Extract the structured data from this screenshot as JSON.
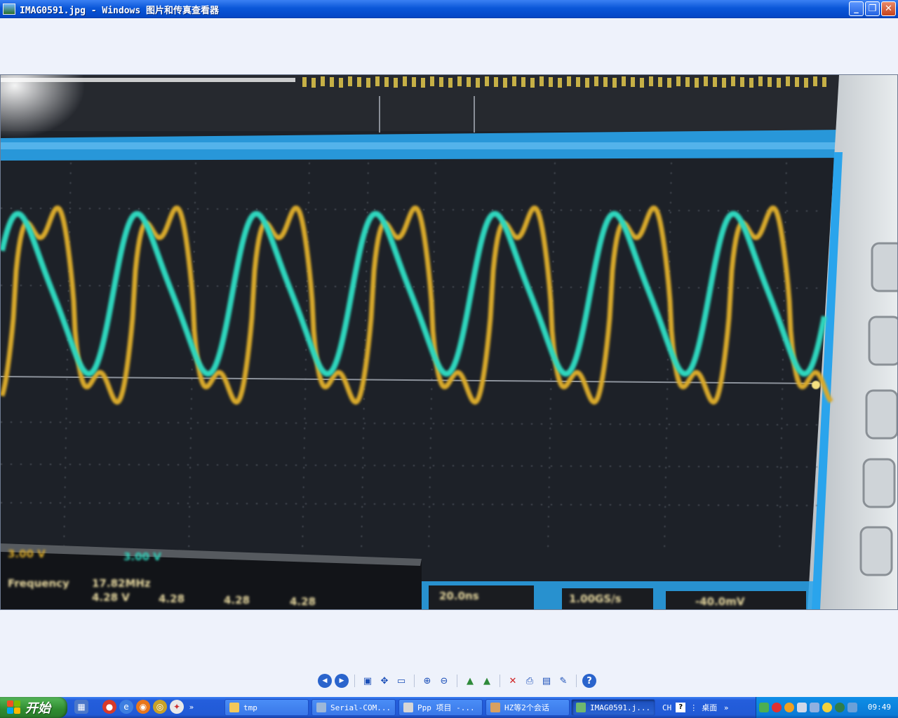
{
  "window": {
    "title": "IMAG0591.jpg - Windows 图片和传真查看器",
    "minimize_label": "_",
    "maximize_label": "❐",
    "close_label": "✕"
  },
  "image": {
    "bottom_readouts": [
      "3.00 V",
      "3.00 V",
      "Frequency",
      "17.82MHz",
      "4.28 V",
      "4.28",
      "4.28",
      "4.28",
      "20.0ns",
      "1.00GS/s",
      "-40.0mV"
    ]
  },
  "viewer_toolbar": {
    "buttons": [
      {
        "name": "previous-image-button",
        "glyph": "◀"
      },
      {
        "name": "next-image-button",
        "glyph": "▶"
      },
      {
        "name": "best-fit-button",
        "glyph": "▣"
      },
      {
        "name": "actual-size-button",
        "glyph": "✥"
      },
      {
        "name": "slideshow-button",
        "glyph": "▭"
      },
      {
        "name": "zoom-in-button",
        "glyph": "⊕"
      },
      {
        "name": "zoom-out-button",
        "glyph": "⊖"
      },
      {
        "name": "rotate-clockwise-button",
        "glyph": "▲"
      },
      {
        "name": "rotate-counterclockwise-button",
        "glyph": "▲"
      },
      {
        "name": "delete-button",
        "glyph": "✕"
      },
      {
        "name": "print-button",
        "glyph": "⎙"
      },
      {
        "name": "save-copy-button",
        "glyph": "▤"
      },
      {
        "name": "open-for-editing-button",
        "glyph": "✎"
      },
      {
        "name": "help-button",
        "glyph": "?"
      }
    ]
  },
  "taskbar": {
    "start_label": "开始",
    "overflow_glyph": "»",
    "tasks": [
      {
        "label": "tmp",
        "color": "#f3c85a"
      },
      {
        "label": "Serial-COM...",
        "color": "#9db7d8"
      },
      {
        "label": "Ppp 项目 -...",
        "color": "#d6d6d6"
      },
      {
        "label": "HZ等2个会话",
        "color": "#d8a060"
      },
      {
        "label": "IMAG0591.j...",
        "color": "#6fb76f"
      }
    ],
    "language": "CH",
    "help": "?",
    "desktop_label": "桌面",
    "clock": "09:49"
  },
  "colors": {
    "trace_cyan": "#2fd6bd",
    "trace_yellow": "#d8a92a",
    "scope_frame_blue": "#2aa4ec",
    "start_green": "#3a9a3a",
    "taskbar_blue": "#245edc"
  }
}
